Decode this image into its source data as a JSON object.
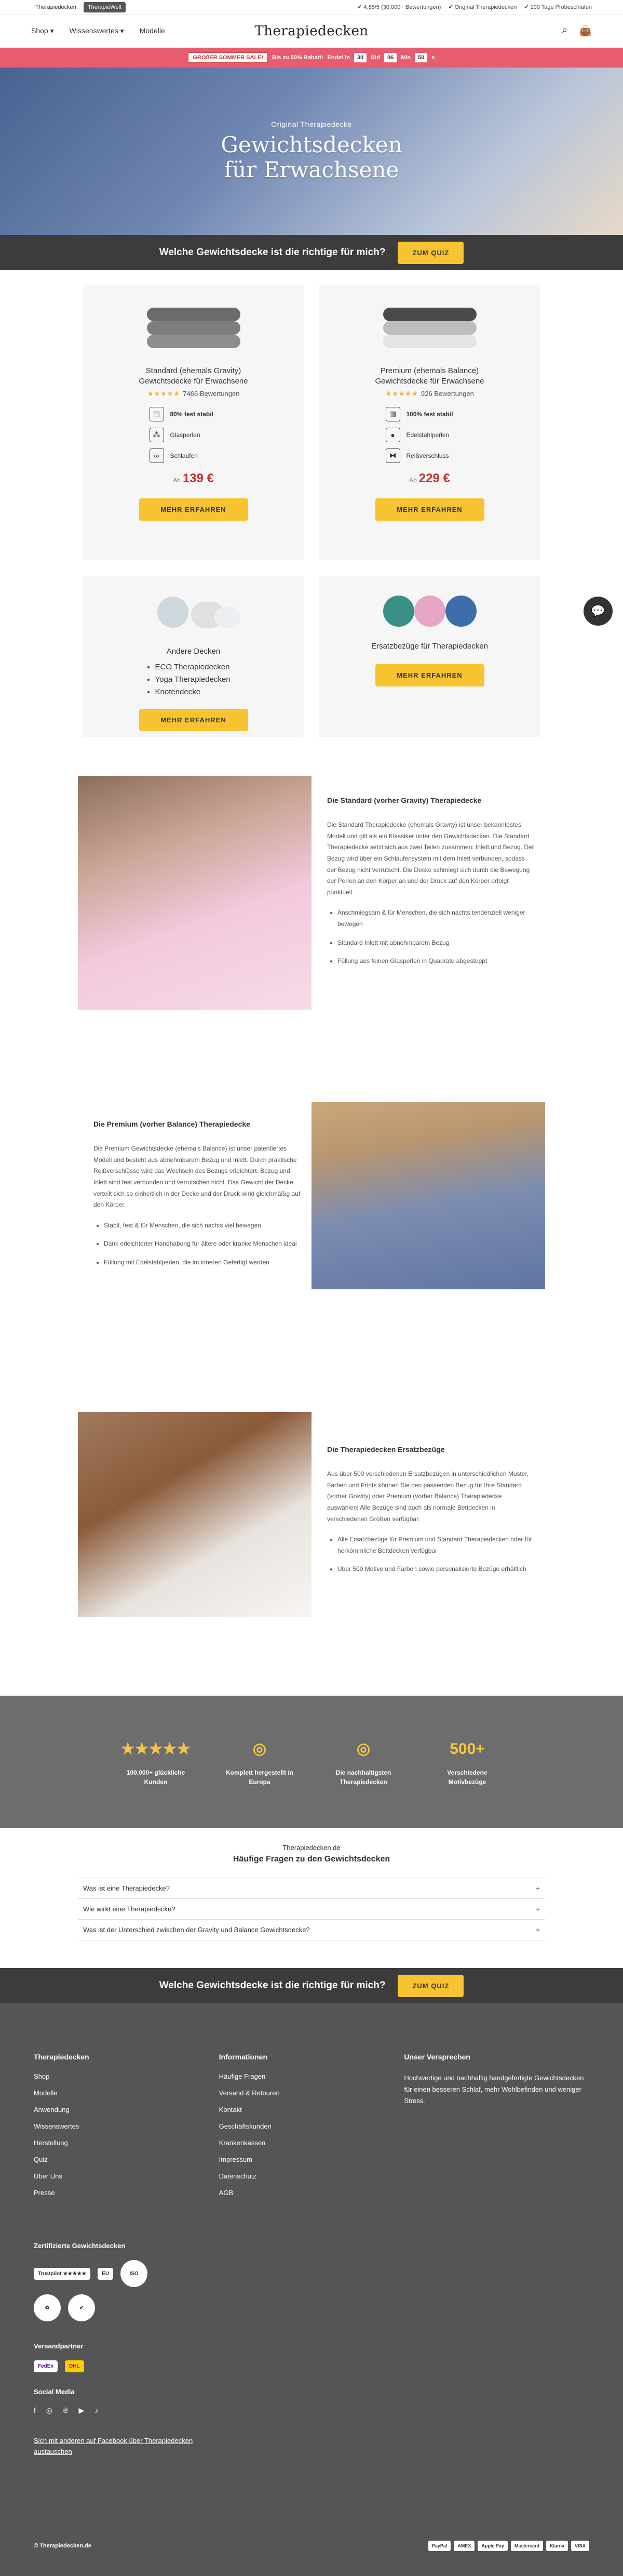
{
  "topbar": {
    "tabs": [
      "Therapiedecken",
      "TherapieWelt"
    ],
    "usps": [
      "4,85/5 (30.000+ Bewertungen)",
      "Original Therapiedecken",
      "100 Tage Probeschlafen"
    ]
  },
  "header": {
    "logo": "Therapiedecken",
    "nav": [
      "Shop",
      "Wissenswertes",
      "Modelle"
    ]
  },
  "promo": {
    "label": "GROßER SOMMER SALE!",
    "text": "Bis zu 50% Rabatt!",
    "ends": "Endet in",
    "countdown": [
      "30",
      "Std",
      "06",
      "Min",
      "50",
      "s"
    ]
  },
  "hero": {
    "sub": "Original Therapiedecke",
    "title_line1": "Gewichtsdecken",
    "title_line2": "für Erwachsene"
  },
  "quiz": {
    "text": "Welche Gewichtsdecke ist die richtige für mich?",
    "button": "ZUM QUIZ"
  },
  "products": {
    "standard": {
      "title_line1": "Standard (ehemals Gravity)",
      "title_line2": "Gewichtsdecke für Erwachsene",
      "stars": "★★★★★",
      "reviews": "7466 Bewertungen",
      "features": [
        "80% fest stabil",
        "Glasperlen",
        "Schlaufen"
      ],
      "price_prefix": "Ab",
      "price": "139 €",
      "button": "MEHR ERFAHREN"
    },
    "premium": {
      "title_line1": "Premium (ehemals Balance)",
      "title_line2": "Gewichtsdecke für Erwachsene",
      "stars": "★★★★★",
      "reviews": "926 Bewertungen",
      "features": [
        "100% fest stabil",
        "Edelstahlperlen",
        "Reißverschluss"
      ],
      "price_prefix": "Ab",
      "price": "229 €",
      "button": "MEHR ERFAHREN"
    },
    "andere": {
      "title": "Andere Decken",
      "items": [
        "ECO Therapiedecken",
        "Yoga Therapiedecken",
        "Knotendecke"
      ],
      "button": "MEHR ERFAHREN"
    },
    "bezuege": {
      "title": "Ersatzbezüge für Therapiedecken",
      "button": "MEHR ERFAHREN"
    }
  },
  "sections": {
    "standard": {
      "title": "Die Standard (vorher Gravity) Therapiedecke",
      "text": "Die Standard Therapiedecke (ehemals Gravity) ist unser bekanntestes Modell und gilt als ein Klassiker unter den Gewichtsdecken. Die Standard Therapiedecke setzt sich aus zwei Teilen zusammen: Inlett und Bezug. Der Bezug wird über ein Schlaufensystem mit dem Inlett verbunden, sodass der Bezug nicht verrutscht. Die Decke schmiegt sich durch die Bewegung der Perlen an den Körper an und der Druck auf den Körper erfolgt punktuell.",
      "bullets": [
        "Anschmiegsam & für Menschen, die sich nachts tendenziell weniger bewegen",
        "Standard Inlett mit abnehmbarem Bezug",
        "Füllung aus feinen Glasperlen in Quadrate abgesteppt"
      ]
    },
    "premium": {
      "title": "Die Premium (vorher Balance) Therapiedecke",
      "text": "Die Premium Gewichtsdecke (ehemals Balance) ist unser patentiertes Modell und besteht aus abnehmbarem Bezug und Inlett. Durch praktische Reißverschlüsse wird das Wechseln des Bezugs erleichtert. Bezug und Inlett sind fest verbunden und verrutschen nicht. Das Gewicht der Decke verteilt sich so einheitlich in der Decke und der Druck wirkt gleichmäßig auf den Körper.",
      "bullets": [
        "Stabil, fest & für Menschen, die sich nachts viel bewegen",
        "Dank erleichterter Handhabung für ältere oder kranke Menschen ideal",
        "Füllung mit Edelstahlperlen, die im inneren Gefertigt werden"
      ]
    },
    "ersatz": {
      "title": "Die Therapiedecken Ersatzbezüge",
      "text": "Aus über 500 verschiedenen Ersatzbezügen in unterschiedlichen Muster, Farben und Prints können Sie den passenden Bezug für Ihre Standard (vorher Gravity) oder Premium (vorher Balance) Therapiedecke auswählen! Alle Bezüge sind auch als normale Bettdecken in verschiedenen Größen verfügbar.",
      "bullets": [
        "Alle Ersatzbezüge für Premium und Standard Therapiedecken oder für herkömmliche Bettdecken verfügbar",
        "Über 500 Motive und Farben sowie personalisierte Bezüge erhältlich"
      ]
    }
  },
  "strip": [
    {
      "icon": "★★★★★",
      "text": "100.000+ glückliche Kunden"
    },
    {
      "icon": "◎",
      "text": "Komplett hergestellt in Europa"
    },
    {
      "icon": "◎",
      "text": "Die nachhaltigsten Therapiedecken"
    },
    {
      "icon": "500+",
      "text": "Verschiedene Motivbezüge"
    }
  ],
  "faq": {
    "small": "Therapiedecken.de",
    "title": "Häufige Fragen zu den Gewichtsdecken",
    "questions": [
      "Was ist eine Therapiedecke?",
      "Wie wirkt eine Therapiedecke?",
      "Was ist der Unterschied zwischen der Gravity und Balance Gewichtsdecke?"
    ]
  },
  "footer": {
    "col1_title": "Therapiedecken",
    "col1": [
      "Shop",
      "Modelle",
      "Anwendung",
      "Wissenswertes",
      "Herstellung",
      "Quiz",
      "Über Uns",
      "Presse"
    ],
    "col2_title": "Informationen",
    "col2": [
      "Häufige Fragen",
      "Versand & Retouren",
      "Kontakt",
      "Geschäftskunden",
      "Krankenkassen",
      "Impressum",
      "Datenschutz",
      "AGB"
    ],
    "col3_title": "Unser Versprechen",
    "col3_text": "Hochwertige und nachhaltig handgefertigte Gewichtsdecken für einen besseren Schlaf, mehr Wohlbefinden und weniger Stress.",
    "cert_title": "Zertifizierte Gewichtsdecken",
    "cert_badges": [
      "Trustpilot ★★★★★",
      "EU",
      "ISO",
      "♻",
      "✔"
    ],
    "shipping_title": "Versandpartner",
    "shipping": [
      "FedEx",
      "DHL"
    ],
    "social_title": "Social Media",
    "fb_link": "Sich mit anderen auf Facebook über Therapiedecken austauschen",
    "copyright": "© Therapiedecken.de",
    "payments": [
      "PayPal",
      "AMEX",
      "Apple Pay",
      "Mastercard",
      "Klarna",
      "VISA"
    ]
  }
}
